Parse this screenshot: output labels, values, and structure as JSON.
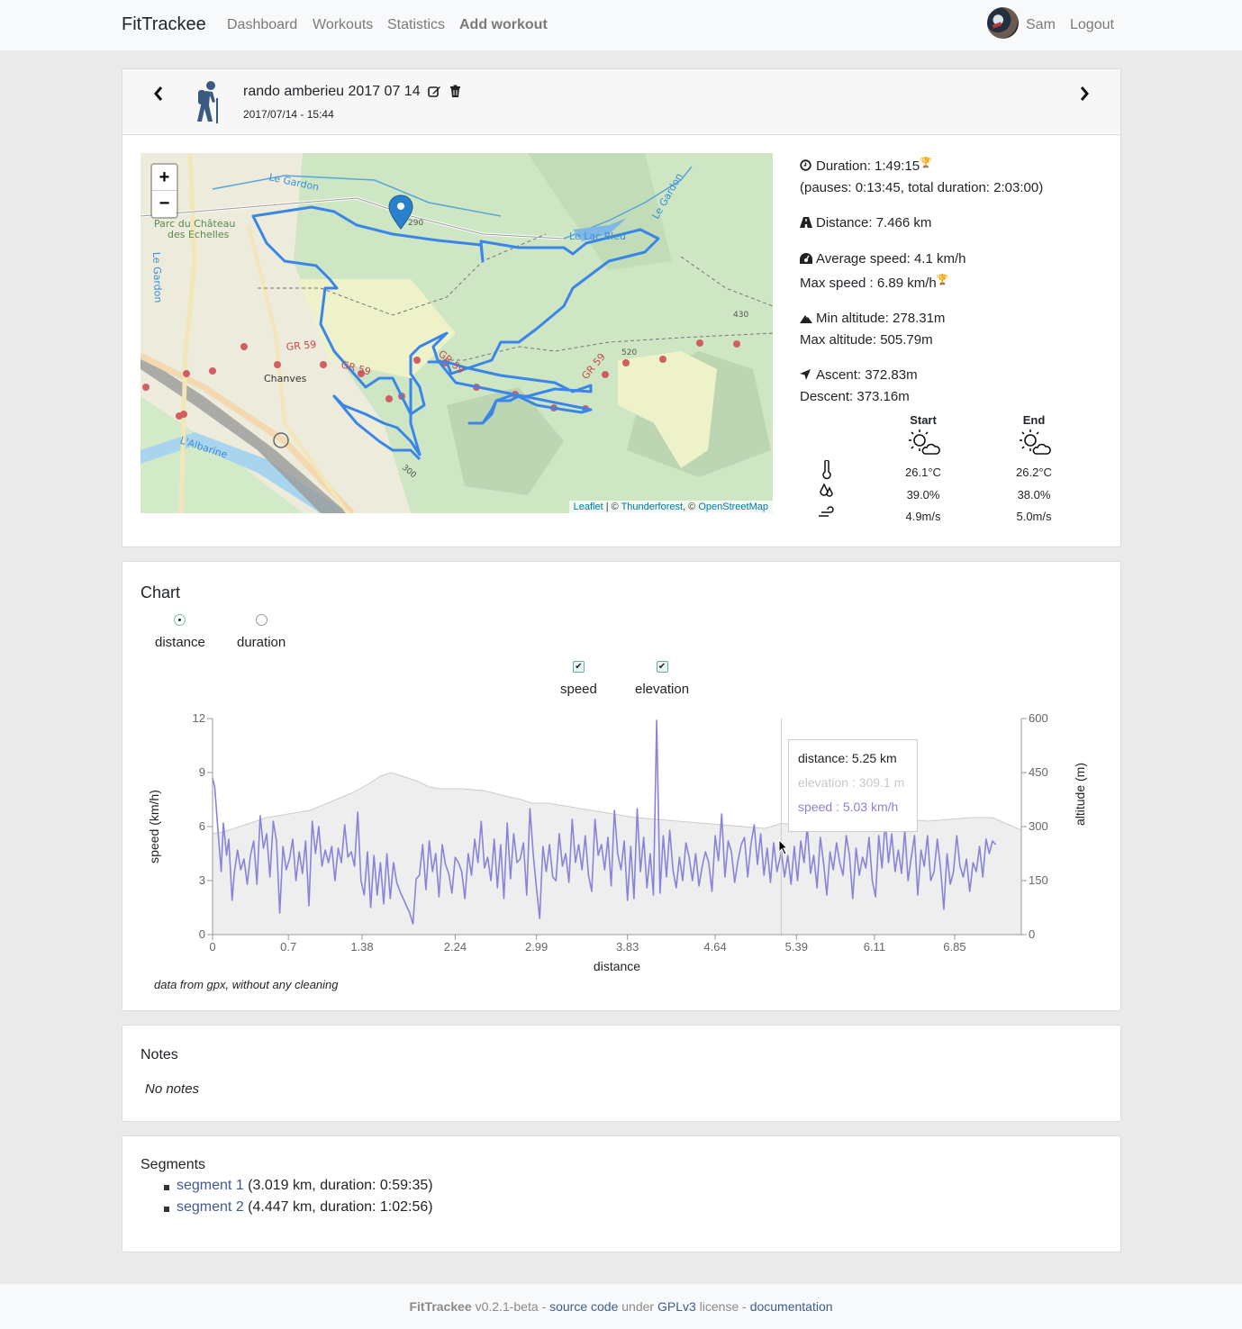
{
  "nav": {
    "brand": "FitTrackee",
    "links": [
      "Dashboard",
      "Workouts",
      "Statistics",
      "Add workout"
    ],
    "user": "Sam",
    "logout": "Logout"
  },
  "workout": {
    "title": "rando amberieu 2017 07 14",
    "date": "2017/07/14 - 15:44",
    "sport_icon": "hiking-icon"
  },
  "map": {
    "labels": {
      "river1": "Le Gardon",
      "river2": "Le Gardon",
      "river3": "Le Gardon",
      "park": "Parc du Château",
      "park2": "des Echelles",
      "lake": "Le Lac Bleu",
      "village": "Chanves",
      "river4": "L'Albarine",
      "trail": "GR 59",
      "alt1": "290",
      "alt2": "430",
      "alt3": "520",
      "alt4": "300"
    },
    "zoom_in": "+",
    "zoom_out": "−",
    "attribution": {
      "leaflet": "Leaflet",
      "sep1": " | © ",
      "thunderforest": "Thunderforest",
      "sep2": ", © ",
      "osm": "OpenStreetMap"
    }
  },
  "stats": {
    "duration": "Duration: 1:49:15",
    "pauses": "(pauses: 0:13:45, total duration: 2:03:00)",
    "distance": "Distance: 7.466 km",
    "avg_speed": "Average speed: 4.1 km/h",
    "max_speed": "Max speed : 6.89 km/h",
    "min_alt": "Min altitude: 278.31m",
    "max_alt": "Max altitude: 505.79m",
    "ascent": "Ascent: 372.83m",
    "descent": "Descent: 373.16m",
    "record_icon": "trophy-icon"
  },
  "weather": {
    "start_label": "Start",
    "end_label": "End",
    "start": {
      "temperature": "26.1°C",
      "humidity": "39.0%",
      "wind": "4.9m/s"
    },
    "end": {
      "temperature": "26.2°C",
      "humidity": "38.0%",
      "wind": "5.0m/s"
    }
  },
  "chart_section": {
    "title": "Chart",
    "x_options": [
      {
        "label": "distance",
        "selected": true
      },
      {
        "label": "duration",
        "selected": false
      }
    ],
    "series_toggles": [
      {
        "label": "speed",
        "checked": true
      },
      {
        "label": "elevation",
        "checked": true
      }
    ],
    "note": "data from gpx, without any cleaning",
    "tooltip": {
      "distance": "distance: 5.25 km",
      "elevation": "elevation : 309.1 m",
      "speed": "speed : 5.03 km/h"
    }
  },
  "chart_data": {
    "type": "line",
    "xlabel": "distance",
    "ylabel": "speed (km/h)",
    "y2label": "altitude (m)",
    "xlim": [
      0,
      7.466
    ],
    "ylim": [
      0,
      12
    ],
    "y2lim": [
      0,
      600
    ],
    "x_ticks": [
      "0",
      "0.7",
      "1.38",
      "2.24",
      "2.99",
      "3.83",
      "4.64",
      "5.39",
      "6.11",
      "6.85"
    ],
    "x_tick_values": [
      0,
      0.7,
      1.38,
      2.24,
      2.99,
      3.83,
      4.64,
      5.39,
      6.11,
      6.85
    ],
    "y_ticks": [
      "0",
      "3",
      "6",
      "9",
      "12"
    ],
    "y2_ticks": [
      "0",
      "150",
      "300",
      "450",
      "600"
    ],
    "hover_x": 5.25,
    "colors": {
      "speed": "#8884d8",
      "elevation_fill": "#eeeeee",
      "elevation_line": "#cccccc"
    },
    "series": [
      {
        "name": "elevation",
        "axis": "right",
        "x": [
          0,
          0.1,
          0.3,
          0.5,
          0.7,
          0.9,
          1.1,
          1.3,
          1.45,
          1.55,
          1.65,
          1.75,
          1.9,
          2.0,
          2.1,
          2.3,
          2.5,
          2.7,
          2.85,
          2.95,
          3.1,
          3.3,
          3.5,
          3.7,
          3.9,
          4.1,
          4.3,
          4.5,
          4.7,
          4.9,
          5.1,
          5.25,
          5.4,
          5.6,
          5.8,
          6.0,
          6.2,
          6.4,
          6.6,
          6.8,
          7.0,
          7.2,
          7.466
        ],
        "values": [
          280,
          285,
          305,
          325,
          335,
          345,
          370,
          395,
          420,
          440,
          450,
          440,
          425,
          410,
          405,
          405,
          400,
          385,
          375,
          365,
          365,
          355,
          345,
          335,
          325,
          320,
          315,
          310,
          305,
          300,
          295,
          309,
          305,
          305,
          315,
          310,
          315,
          320,
          315,
          320,
          325,
          325,
          290
        ]
      },
      {
        "name": "speed",
        "axis": "left",
        "x": [
          0,
          0.02,
          0.05,
          0.08,
          0.1,
          0.13,
          0.15,
          0.18,
          0.2,
          0.23,
          0.26,
          0.29,
          0.32,
          0.35,
          0.38,
          0.41,
          0.44,
          0.47,
          0.5,
          0.53,
          0.56,
          0.59,
          0.62,
          0.65,
          0.68,
          0.71,
          0.74,
          0.77,
          0.8,
          0.83,
          0.86,
          0.89,
          0.92,
          0.95,
          0.98,
          1.01,
          1.04,
          1.07,
          1.1,
          1.13,
          1.16,
          1.19,
          1.22,
          1.25,
          1.28,
          1.31,
          1.34,
          1.37,
          1.4,
          1.43,
          1.46,
          1.49,
          1.52,
          1.55,
          1.58,
          1.61,
          1.64,
          1.67,
          1.7,
          1.73,
          1.76,
          1.79,
          1.82,
          1.85,
          1.88,
          1.91,
          1.94,
          1.97,
          2.0,
          2.03,
          2.06,
          2.09,
          2.12,
          2.15,
          2.18,
          2.21,
          2.24,
          2.27,
          2.3,
          2.33,
          2.36,
          2.39,
          2.42,
          2.45,
          2.48,
          2.51,
          2.54,
          2.57,
          2.6,
          2.63,
          2.66,
          2.69,
          2.72,
          2.75,
          2.78,
          2.81,
          2.84,
          2.87,
          2.9,
          2.93,
          2.96,
          2.99,
          3.02,
          3.05,
          3.08,
          3.11,
          3.14,
          3.17,
          3.2,
          3.23,
          3.26,
          3.29,
          3.32,
          3.35,
          3.38,
          3.41,
          3.44,
          3.47,
          3.5,
          3.53,
          3.56,
          3.59,
          3.62,
          3.65,
          3.68,
          3.71,
          3.74,
          3.77,
          3.8,
          3.83,
          3.86,
          3.89,
          3.92,
          3.95,
          3.98,
          4.01,
          4.04,
          4.07,
          4.1,
          4.13,
          4.16,
          4.19,
          4.22,
          4.25,
          4.28,
          4.31,
          4.34,
          4.37,
          4.4,
          4.43,
          4.46,
          4.49,
          4.52,
          4.55,
          4.58,
          4.61,
          4.64,
          4.67,
          4.7,
          4.73,
          4.76,
          4.79,
          4.82,
          4.85,
          4.88,
          4.91,
          4.94,
          4.97,
          5.0,
          5.03,
          5.06,
          5.09,
          5.12,
          5.15,
          5.18,
          5.21,
          5.25,
          5.28,
          5.31,
          5.34,
          5.37,
          5.4,
          5.43,
          5.46,
          5.49,
          5.52,
          5.55,
          5.58,
          5.61,
          5.64,
          5.67,
          5.7,
          5.73,
          5.76,
          5.79,
          5.82,
          5.85,
          5.88,
          5.91,
          5.94,
          5.97,
          6.0,
          6.03,
          6.06,
          6.09,
          6.12,
          6.15,
          6.18,
          6.21,
          6.24,
          6.27,
          6.3,
          6.33,
          6.36,
          6.39,
          6.42,
          6.45,
          6.48,
          6.51,
          6.54,
          6.57,
          6.6,
          6.63,
          6.66,
          6.69,
          6.72,
          6.75,
          6.78,
          6.81,
          6.84,
          6.87,
          6.9,
          6.93,
          6.96,
          6.99,
          7.02,
          7.05,
          7.08,
          7.11,
          7.14,
          7.17,
          7.2,
          7.23,
          7.26,
          7.29,
          7.32,
          7.35,
          7.38,
          7.41,
          7.44,
          7.466
        ],
        "values": [
          8.7,
          8.2,
          5.8,
          3.5,
          6.2,
          4.4,
          5.3,
          1.9,
          3.4,
          4.7,
          3.6,
          4.2,
          2.8,
          4.4,
          5.2,
          2.8,
          6.6,
          4.8,
          5.6,
          3.2,
          6.3,
          5.2,
          1.2,
          4.9,
          3.6,
          4.2,
          5.3,
          3.0,
          4.6,
          3.4,
          5.2,
          1.6,
          6.3,
          4.5,
          6.0,
          3.8,
          4.7,
          4.0,
          4.9,
          3.0,
          4.8,
          4.0,
          6.1,
          4.3,
          4.6,
          3.8,
          6.8,
          3.0,
          2.2,
          4.6,
          1.5,
          4.4,
          2.2,
          4.0,
          1.7,
          4.5,
          2.0,
          4.0,
          2.9,
          2.4,
          2.0,
          1.6,
          1.2,
          0.6,
          3.1,
          3.3,
          5.0,
          2.5,
          5.2,
          3.5,
          4.5,
          2.1,
          5.0,
          3.9,
          3.4,
          2.3,
          4.3,
          4.0,
          3.5,
          2.0,
          4.5,
          3.3,
          5.3,
          4.0,
          6.3,
          3.7,
          4.3,
          3.0,
          5.3,
          2.6,
          5.0,
          2.0,
          6.2,
          3.1,
          5.6,
          4.0,
          4.2,
          5.1,
          2.2,
          7.0,
          4.5,
          2.6,
          0.9,
          4.9,
          3.5,
          5.0,
          3.2,
          3.0,
          5.6,
          3.8,
          4.5,
          2.9,
          6.4,
          4.0,
          5.0,
          3.6,
          5.5,
          3.3,
          2.4,
          6.4,
          4.4,
          5.0,
          3.6,
          5.4,
          2.7,
          6.9,
          4.5,
          3.6,
          5.2,
          1.9,
          4.9,
          2.0,
          7.0,
          3.5,
          5.4,
          2.6,
          4.5,
          2.2,
          11.9,
          2.3,
          5.5,
          3.2,
          5.8,
          3.6,
          2.6,
          4.3,
          3.0,
          5.1,
          4.3,
          3.0,
          4.5,
          2.7,
          3.8,
          4.6,
          4.0,
          2.4,
          5.5,
          4.1,
          6.7,
          3.2,
          5.2,
          4.6,
          2.9,
          4.1,
          5.0,
          5.4,
          3.2,
          5.03,
          6.1,
          3.9,
          5.6,
          3.3,
          4.8,
          2.9,
          5.1,
          3.5,
          4.6,
          3.2,
          4.4,
          2.8,
          4.9,
          3.0,
          5.2,
          4.0,
          6.0,
          3.4,
          4.4,
          2.6,
          5.4,
          4.0,
          2.2,
          4.6,
          3.6,
          5.1,
          4.0,
          3.3,
          5.5,
          4.4,
          2.0,
          4.8,
          3.3,
          4.3,
          3.7,
          5.4,
          3.0,
          2.1,
          5.5,
          3.7,
          6.3,
          4.0,
          5.6,
          3.5,
          4.7,
          3.4,
          5.8,
          3.0,
          4.3,
          5.5,
          2.2,
          4.7,
          3.8,
          5.5,
          3.0,
          3.5,
          5.3,
          3.7,
          1.4,
          4.5,
          2.8,
          3.5,
          5.5,
          3.8,
          3.2,
          4.2,
          2.4,
          4.0,
          3.5,
          4.9,
          3.2,
          5.3,
          4.5,
          5.2,
          5.0
        ]
      }
    ]
  },
  "notes": {
    "title": "Notes",
    "text": "No notes"
  },
  "segments": {
    "title": "Segments",
    "items": [
      {
        "label": "segment 1",
        "info": " (3.019 km, duration: 0:59:35)"
      },
      {
        "label": "segment 2",
        "info": " (4.447 km, duration: 1:02:56)"
      }
    ]
  },
  "footer": {
    "brand": "FitTrackee",
    "version": " v0.2.1-beta - ",
    "source": "source code",
    "under": " under ",
    "license": "GPLv3",
    "license_suffix": " license - ",
    "docs": "documentation"
  }
}
